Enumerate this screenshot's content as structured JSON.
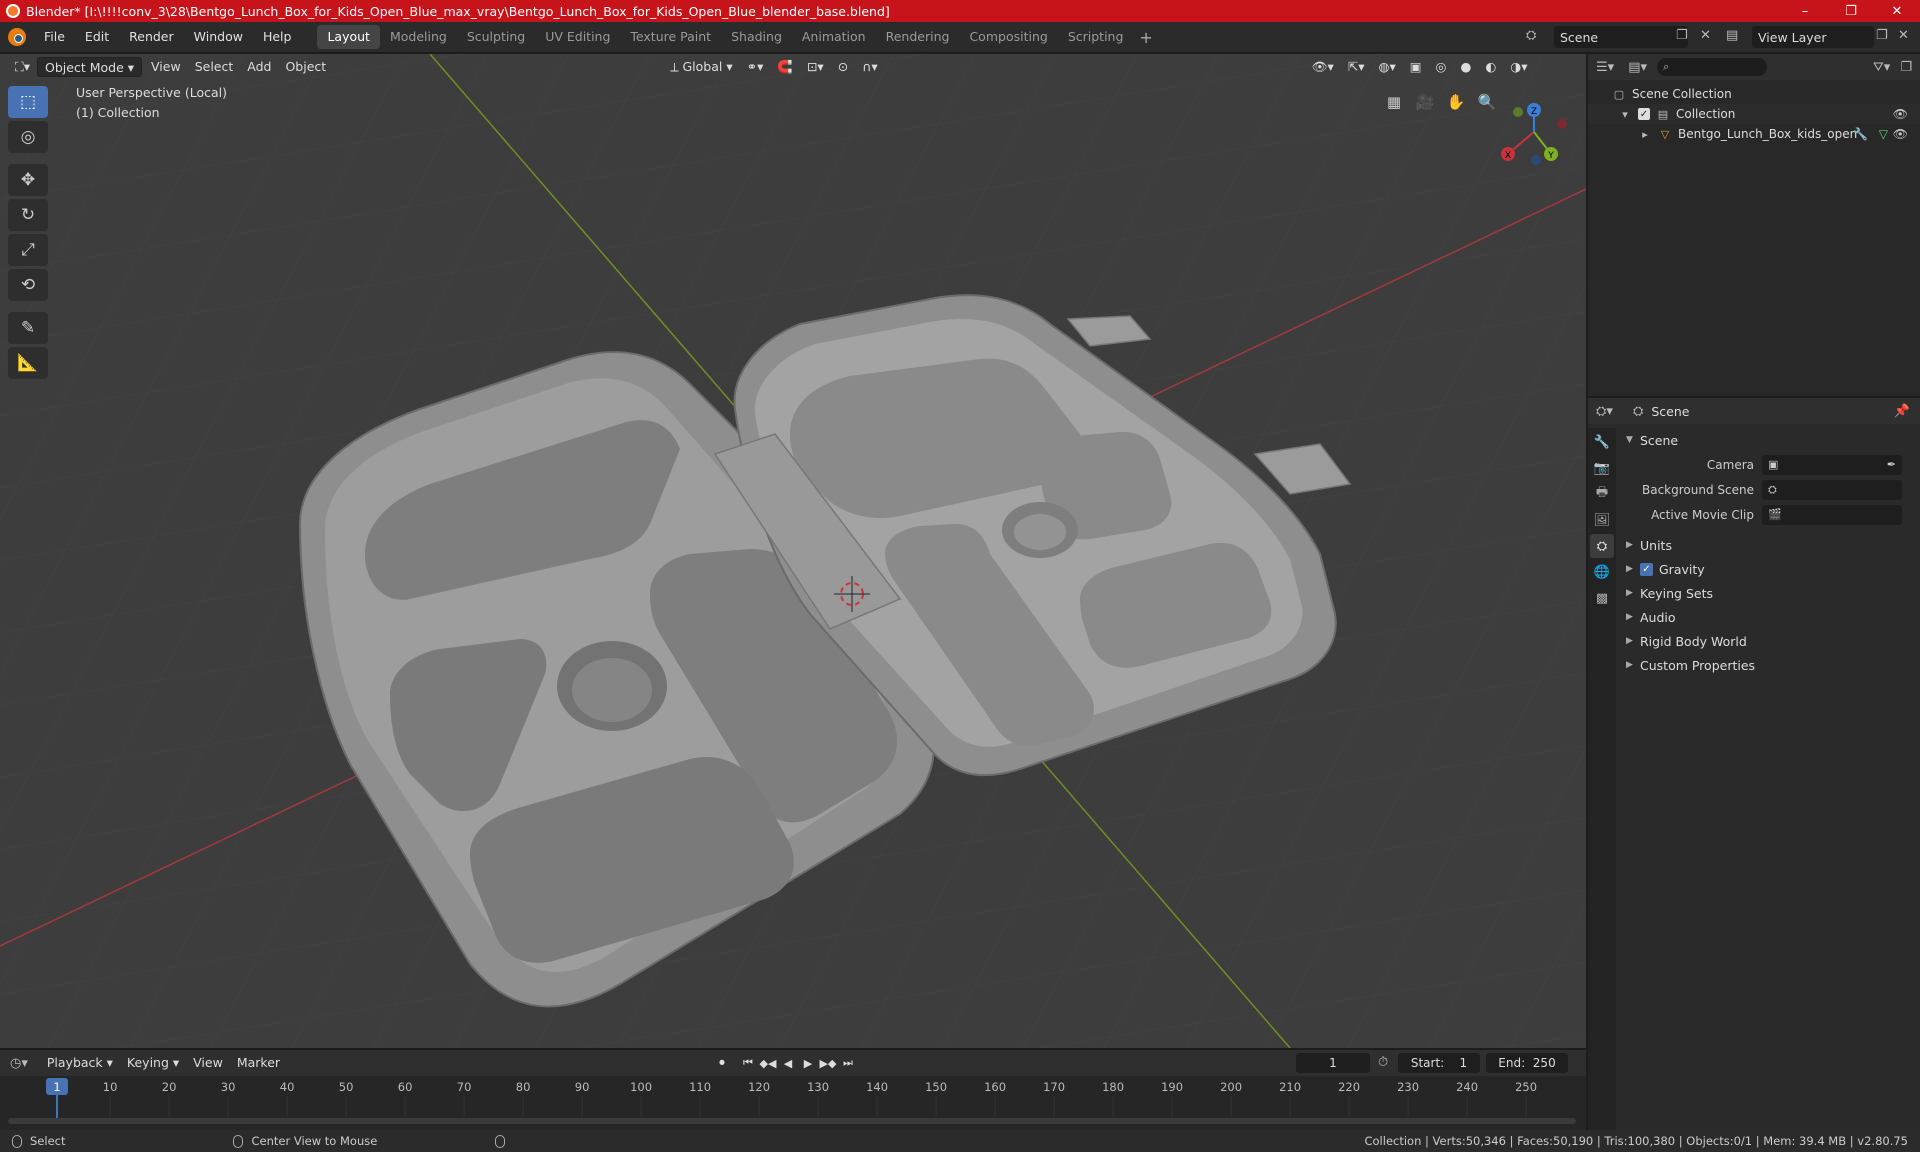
{
  "window": {
    "title": "Blender* [I:\\!!!!conv_3\\28\\Bentgo_Lunch_Box_for_Kids_Open_Blue_max_vray\\Bentgo_Lunch_Box_for_Kids_Open_Blue_blender_base.blend]",
    "minimize": "–",
    "maximize": "❐",
    "close": "✕"
  },
  "menu": [
    "File",
    "Edit",
    "Render",
    "Window",
    "Help"
  ],
  "workspaces": [
    "Layout",
    "Modeling",
    "Sculpting",
    "UV Editing",
    "Texture Paint",
    "Shading",
    "Animation",
    "Rendering",
    "Compositing",
    "Scripting"
  ],
  "workspace_add": "+",
  "scene_selector": "Scene",
  "view_layer": "View Layer",
  "viewport": {
    "mode": "Object Mode",
    "menus": [
      "View",
      "Select",
      "Add",
      "Object"
    ],
    "transform_orientation": "Global",
    "perspective_label": "User Perspective (Local)",
    "collection_label": "(1) Collection",
    "gizmo_axes": {
      "x": "X",
      "y": "Y",
      "z": "Z"
    }
  },
  "tools": [
    "select-box",
    "cursor",
    "move",
    "rotate",
    "scale",
    "transform",
    "annotate",
    "measure"
  ],
  "tool_glyphs": [
    "⬚",
    "◎",
    "✥",
    "↻",
    "⤢",
    "⟲",
    "✎",
    "📐"
  ],
  "outliner": {
    "search_icon": "⌕",
    "rows": [
      {
        "label": "Scene Collection",
        "icon": "scene-collection-icon",
        "glyph": "▢"
      },
      {
        "label": "Collection",
        "icon": "collection-icon",
        "glyph": "▤"
      },
      {
        "label": "Bentgo_Lunch_Box_kids_open",
        "icon": "mesh-object-icon",
        "glyph": "▽"
      }
    ]
  },
  "properties": {
    "header": "Scene",
    "panel": "Scene",
    "fields": [
      {
        "label": "Camera",
        "value": ""
      },
      {
        "label": "Background Scene",
        "value": ""
      },
      {
        "label": "Active Movie Clip",
        "value": ""
      }
    ],
    "subpanels": [
      "Units",
      "Gravity",
      "Keying Sets",
      "Audio",
      "Rigid Body World",
      "Custom Properties"
    ]
  },
  "timeline": {
    "menus": [
      "Playback",
      "Keying",
      "View",
      "Marker"
    ],
    "current_frame": "1",
    "start_label": "Start:",
    "start": "1",
    "end_label": "End:",
    "end": "250",
    "ticks": [
      "1",
      "10",
      "20",
      "30",
      "40",
      "50",
      "60",
      "70",
      "80",
      "90",
      "100",
      "110",
      "120",
      "130",
      "140",
      "150",
      "160",
      "170",
      "180",
      "190",
      "200",
      "210",
      "220",
      "230",
      "240",
      "250"
    ]
  },
  "status": {
    "left1": "Select",
    "left2": "Center View to Mouse",
    "right": "Collection | Verts:50,346 | Faces:50,190 | Tris:100,380 | Objects:0/1 | Mem: 39.4 MB | v2.80.75"
  },
  "colors": {
    "title_bar": "#c7141a",
    "accent": "#4772b3",
    "viewport_bg": "#3d3d3d",
    "x_axis": "#c8323c",
    "y_axis": "#7fb020",
    "z_axis": "#3d7ed6"
  }
}
